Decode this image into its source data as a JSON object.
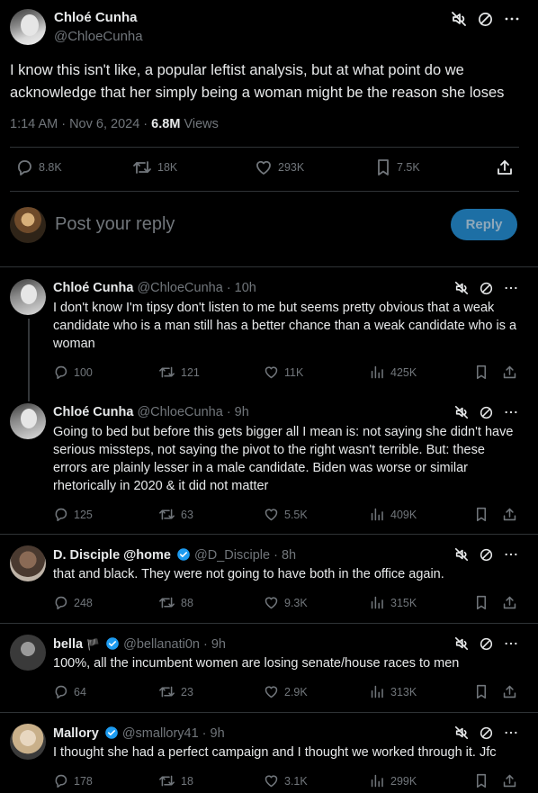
{
  "main_tweet": {
    "author_name": "Chloé Cunha",
    "handle": "@ChloeCunha",
    "text": "I know this isn't like, a popular leftist analysis, but at what point do we acknowledge that her simply being a woman might be the reason she loses",
    "time": "1:14 AM · Nov 6, 2024 · ",
    "views_count": "6.8M",
    "views_label": "Views",
    "replies": "8.8K",
    "reposts": "18K",
    "likes": "293K",
    "bookmarks": "7.5K"
  },
  "reply_box": {
    "placeholder": "Post your reply",
    "button": "Reply"
  },
  "replies": [
    {
      "name": "Chloé Cunha",
      "handle": "@ChloeCunha · 10h",
      "text": "I don't know I'm tipsy don't listen to me but seems pretty obvious that a weak candidate who is a man still has a better chance than a weak candidate who is a woman",
      "replies": "100",
      "reposts": "121",
      "likes": "11K",
      "views": "425K"
    },
    {
      "name": "Chloé Cunha",
      "handle": "@ChloeCunha · 9h",
      "text": "Going to bed but before this gets bigger all I mean is: not saying she didn't have serious missteps, not saying the pivot to the right wasn't terrible. But: these errors are plainly lesser in a male candidate. Biden was worse or similar rhetorically in 2020 & it did not matter",
      "replies": "125",
      "reposts": "63",
      "likes": "5.5K",
      "views": "409K"
    },
    {
      "name": "D. Disciple @home",
      "handle": "@D_Disciple · 8h",
      "text": "that and black. They were not going to have both in the office again.",
      "replies": "248",
      "reposts": "88",
      "likes": "9.3K",
      "views": "315K"
    },
    {
      "name": "bella",
      "name_extra": "🏴",
      "handle": "@bellanati0n · 9h",
      "text": "100%, all the incumbent women are losing senate/house races to men",
      "replies": "64",
      "reposts": "23",
      "likes": "2.9K",
      "views": "313K"
    },
    {
      "name": "Mallory",
      "handle": "@smallory41 · 9h",
      "text": "I thought she had a perfect campaign and I thought we worked through it. Jfc",
      "replies": "178",
      "reposts": "18",
      "likes": "3.1K",
      "views": "299K"
    }
  ],
  "colors": {
    "background": "#000000",
    "text": "#e7e9ea",
    "muted": "#71767b",
    "border": "#2f3336",
    "reply_button": "#1d6fa5",
    "verified": "#1d9bf0"
  },
  "icons": [
    "mute-icon",
    "block-icon",
    "more-icon",
    "reply-icon",
    "repost-icon",
    "like-icon",
    "bookmark-icon",
    "share-icon",
    "views-icon",
    "verified-badge-icon"
  ]
}
